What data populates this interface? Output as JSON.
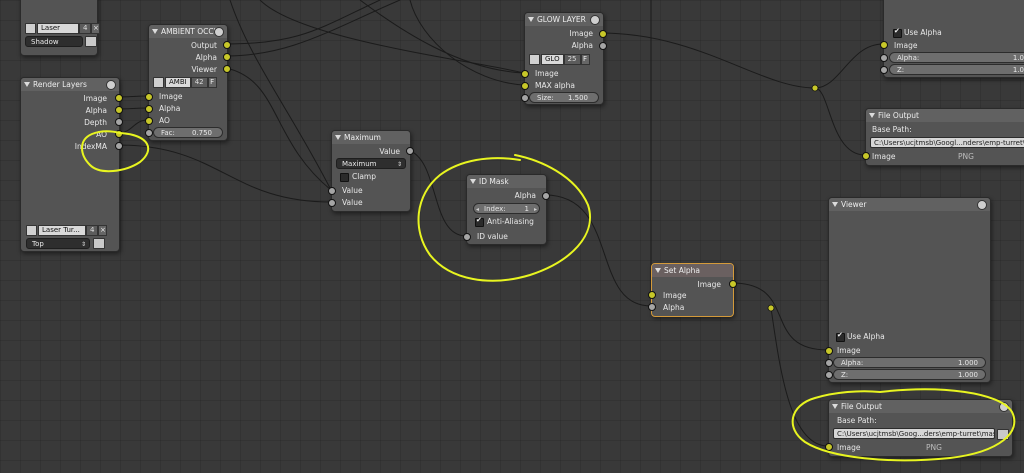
{
  "nodes": {
    "laser_top": {
      "name_field": "Laser",
      "users": "4",
      "layer_dropdown": "Shadow"
    },
    "ambient_occlusion": {
      "title": "AMBIENT OCCL.",
      "outputs": [
        "Output",
        "Alpha",
        "Viewer"
      ],
      "id_name": "AMBI",
      "id_users": "42",
      "fake_user": "F",
      "inputs": [
        "Image",
        "Alpha",
        "AO"
      ],
      "fac_label": "Fac:",
      "fac_value": "0.750"
    },
    "render_layers": {
      "title": "Render Layers",
      "outputs": [
        "Image",
        "Alpha",
        "Depth",
        "AO",
        "IndexMA"
      ],
      "scene_name": "Laser Tur...",
      "scene_users": "4",
      "layer_dropdown": "Top"
    },
    "maximum": {
      "title": "Maximum",
      "output": "Value",
      "operation": "Maximum",
      "clamp_label": "Clamp",
      "inputs": [
        "Value",
        "Value"
      ]
    },
    "glow_layer": {
      "title": "GLOW LAYER",
      "outputs": [
        "Image",
        "Alpha"
      ],
      "id_name": "GLO",
      "id_users": "25",
      "fake_user": "F",
      "inputs": [
        "Image",
        "MAX alpha"
      ],
      "size_label": "Size:",
      "size_value": "1.500"
    },
    "id_mask": {
      "title": "ID Mask",
      "output": "Alpha",
      "index_label": "Index:",
      "index_value": "1",
      "antialias_label": "Anti-Aliasing",
      "input": "ID value"
    },
    "set_alpha": {
      "title": "Set Alpha",
      "output": "Image",
      "inputs": [
        "Image",
        "Alpha"
      ]
    },
    "composite_top": {
      "use_alpha_label": "Use Alpha",
      "input": "Image",
      "alpha_label": "Alpha:",
      "alpha_value": "1.0",
      "z_label": "Z:",
      "z_value": "1.0"
    },
    "file_output_top": {
      "title": "File Output",
      "base_path_label": "Base Path:",
      "base_path": "C:\\Users\\ucjtmsb\\Googl...nders\\emp-turret\\glow",
      "input": "Image",
      "format": "PNG"
    },
    "viewer": {
      "title": "Viewer",
      "use_alpha_label": "Use Alpha",
      "input": "Image",
      "alpha_label": "Alpha:",
      "alpha_value": "1.000",
      "z_label": "Z:",
      "z_value": "1.000"
    },
    "file_output_bottom": {
      "title": "File Output",
      "base_path_label": "Base Path:",
      "base_path": "C:\\Users\\ucjtmsb\\Goog...ders\\emp-turret\\masks",
      "input": "Image",
      "format": "PNG"
    }
  },
  "colors": {
    "background": "#393939",
    "node_body": "#545454",
    "socket_color": "#c7c729",
    "socket_value": "#a5a5a5",
    "link": "#1a1a1a",
    "annotation": "#e8f520"
  }
}
